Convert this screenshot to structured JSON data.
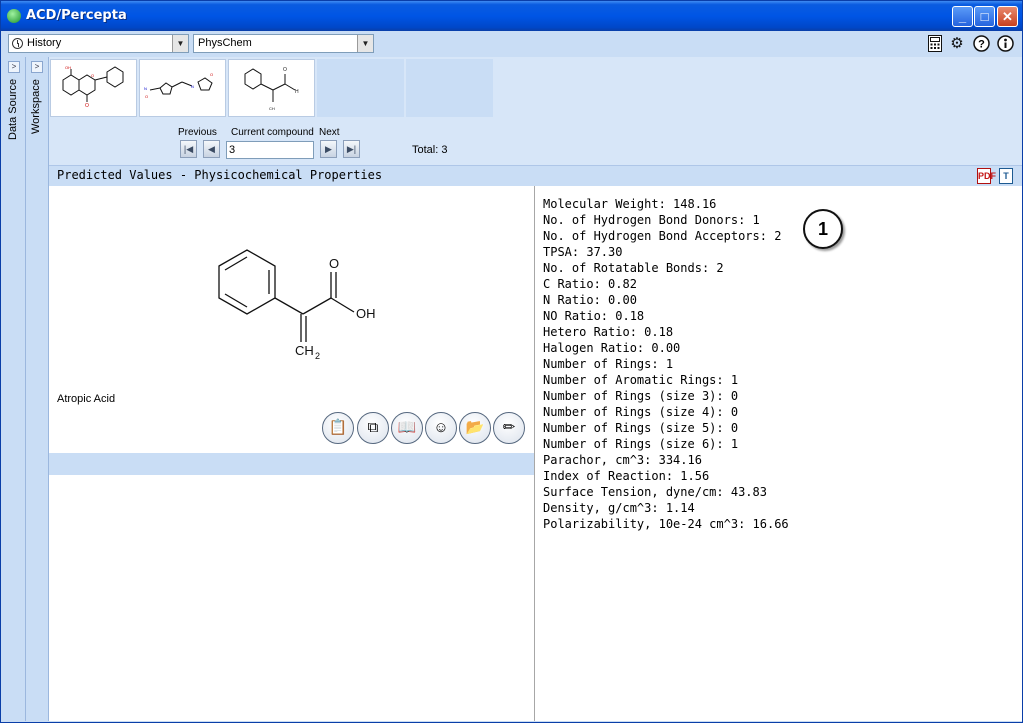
{
  "window": {
    "title": "ACD/Percepta"
  },
  "toolbar": {
    "history_combo": "History",
    "module_combo": "PhysChem",
    "icons": [
      "calculator-icon",
      "gear-icon",
      "help-icon",
      "info-icon"
    ]
  },
  "side": {
    "data_source": "Data Source",
    "workspace": "Workspace"
  },
  "navigation": {
    "previous_label": "Previous",
    "current_label": "Current compound",
    "next_label": "Next",
    "current_value": "3",
    "total_text": "Total: 3"
  },
  "panel": {
    "title": "Predicted Values - Physicochemical Properties"
  },
  "compound": {
    "name": "Atropic Acid",
    "label_o": "O",
    "label_oh": "OH",
    "label_ch2": "CH",
    "label_sub": "2"
  },
  "badge": "1",
  "properties": [
    "Molecular Weight: 148.16",
    "No. of Hydrogen Bond Donors: 1",
    "No. of Hydrogen Bond Acceptors: 2",
    "TPSA: 37.30",
    "No. of Rotatable Bonds: 2",
    "C Ratio: 0.82",
    "N Ratio: 0.00",
    "NO Ratio: 0.18",
    "Hetero Ratio: 0.18",
    "Halogen Ratio: 0.00",
    "Number of Rings: 1",
    "Number of Aromatic Rings: 1",
    "Number of Rings (size 3): 0",
    "Number of Rings (size 4): 0",
    "Number of Rings (size 5): 0",
    "Number of Rings (size 6): 1",
    "Parachor, cm^3: 334.16",
    "Index of Reaction: 1.56",
    "Surface Tension, dyne/cm: 43.83",
    "Density, g/cm^3: 1.14",
    "Polarizability, 10e-24 cm^3: 16.66"
  ]
}
